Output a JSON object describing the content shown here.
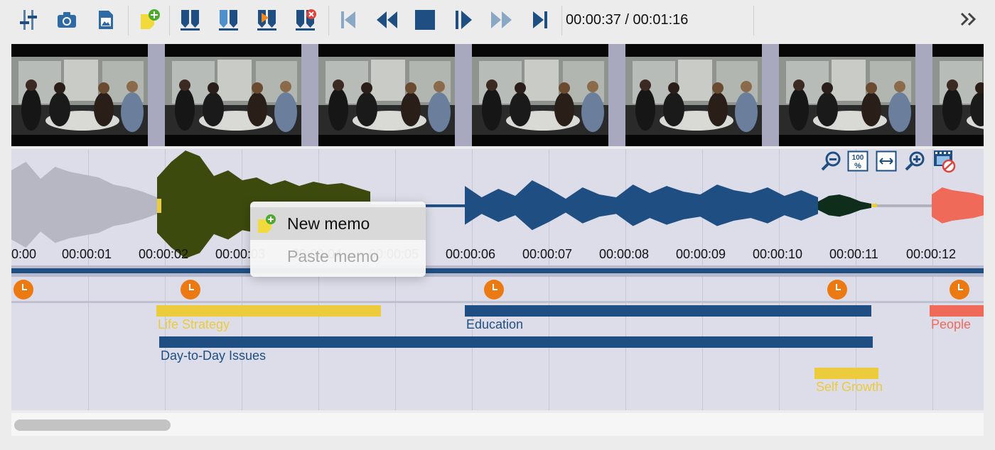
{
  "toolbar": {
    "buttons": [
      {
        "name": "settings-sliders-button",
        "icon": "sliders-icon"
      },
      {
        "name": "snapshot-button",
        "icon": "camera-icon"
      },
      {
        "name": "export-image-button",
        "icon": "image-file-icon"
      },
      {
        "name": "add-memo-button",
        "icon": "memo-add-icon"
      },
      {
        "name": "set-in-point-button",
        "icon": "marker-down-icon"
      },
      {
        "name": "set-out-point-button",
        "icon": "marker-down-light-icon"
      },
      {
        "name": "go-to-marker-button",
        "icon": "marker-play-icon"
      },
      {
        "name": "remove-marker-button",
        "icon": "marker-remove-icon"
      },
      {
        "name": "skip-to-start-button",
        "icon": "skip-start-icon"
      },
      {
        "name": "rewind-button",
        "icon": "rewind-icon"
      },
      {
        "name": "stop-button",
        "icon": "stop-icon"
      },
      {
        "name": "play-button",
        "icon": "play-icon"
      },
      {
        "name": "fast-forward-button",
        "icon": "fast-forward-icon"
      },
      {
        "name": "skip-to-end-button",
        "icon": "skip-end-icon"
      }
    ],
    "timecode": "00:00:37 / 00:01:16",
    "expand_icon": "double-chevron-right-icon"
  },
  "ruler": {
    "labels": [
      "0:00",
      "00:00:01",
      "00:00:02",
      "00:00:03",
      "00:00:04",
      "00:00:05",
      "00:00:06",
      "00:00:07",
      "00:00:08",
      "00:00:09",
      "00:00:10",
      "00:00:11",
      "00:00:12"
    ]
  },
  "zoom_tools": [
    {
      "name": "zoom-out-button",
      "icon": "zoom-out-icon"
    },
    {
      "name": "zoom-100-button",
      "icon": "zoom-100-icon",
      "label": "100 %"
    },
    {
      "name": "fit-width-button",
      "icon": "fit-width-icon"
    },
    {
      "name": "zoom-in-button",
      "icon": "zoom-in-icon"
    },
    {
      "name": "toggle-thumbnails-button",
      "icon": "filmstrip-hide-icon"
    }
  ],
  "codes": [
    {
      "label": "Life Strategy",
      "color": "#eccb3c"
    },
    {
      "label": "Education",
      "color": "#1f4f82"
    },
    {
      "label": "People",
      "color": "#f06a5a"
    },
    {
      "label": "Day-to-Day Issues",
      "color": "#1f4f82"
    },
    {
      "label": "Self Growth",
      "color": "#eccb3c"
    }
  ],
  "context_menu": {
    "items": [
      {
        "label": "New memo",
        "enabled": true,
        "icon": "memo-add-icon"
      },
      {
        "label": "Paste memo",
        "enabled": false
      }
    ]
  },
  "colors": {
    "accent": "#1f4f82",
    "waveform_gray": "#b6b7c2",
    "waveform_olive": "#3c4a0e",
    "waveform_blue": "#1f4f82",
    "waveform_dark": "#0f2d1b",
    "waveform_red": "#f06a5a",
    "clock_orange": "#ec7a12"
  }
}
